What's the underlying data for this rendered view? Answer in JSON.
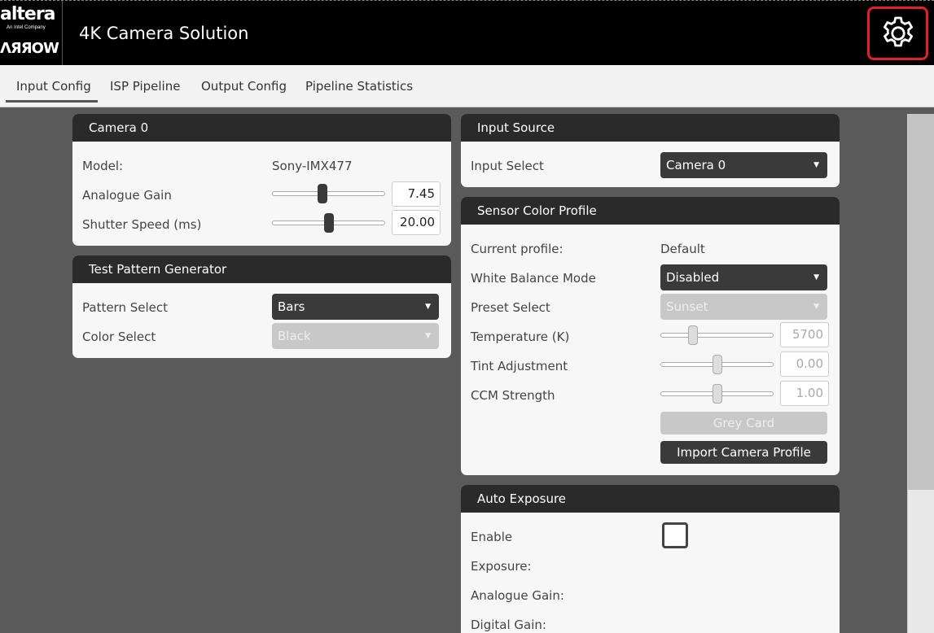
{
  "header": {
    "logo_altera": "altera",
    "logo_intel": "An Intel Company",
    "logo_arrow": "ΛЯЯOW",
    "title": "4K Camera Solution"
  },
  "tabs": [
    "Input Config",
    "ISP Pipeline",
    "Output Config",
    "Pipeline Statistics"
  ],
  "camera0": {
    "title": "Camera 0",
    "model_label": "Model:",
    "model_value": "Sony-IMX477",
    "gain_label": "Analogue Gain",
    "gain_value": "7.45",
    "gain_level": 0.44,
    "shutter_label": "Shutter Speed (ms)",
    "shutter_value": "20.00",
    "shutter_level": 0.5
  },
  "test_pattern": {
    "title": "Test Pattern Generator",
    "pattern_label": "Pattern Select",
    "pattern_value": "Bars",
    "color_label": "Color Select",
    "color_value": "Black"
  },
  "input_source": {
    "title": "Input Source",
    "select_label": "Input Select",
    "select_value": "Camera 0"
  },
  "sensor_profile": {
    "title": "Sensor Color Profile",
    "current_label": "Current profile:",
    "current_value": "Default",
    "wb_label": "White Balance Mode",
    "wb_value": "Disabled",
    "preset_label": "Preset Select",
    "preset_value": "Sunset",
    "temp_label": "Temperature (K)",
    "temp_value": "5700",
    "temp_level": 0.27,
    "tint_label": "Tint Adjustment",
    "tint_value": "0.00",
    "tint_level": 0.5,
    "ccm_label": "CCM Strength",
    "ccm_value": "1.00",
    "ccm_level": 0.5,
    "grey_card": "Grey Card",
    "import": "Import Camera Profile"
  },
  "auto_exposure": {
    "title": "Auto Exposure",
    "enable_label": "Enable",
    "exposure_label": "Exposure:",
    "gain_label": "Analogue Gain:",
    "digital_label": "Digital Gain:"
  }
}
